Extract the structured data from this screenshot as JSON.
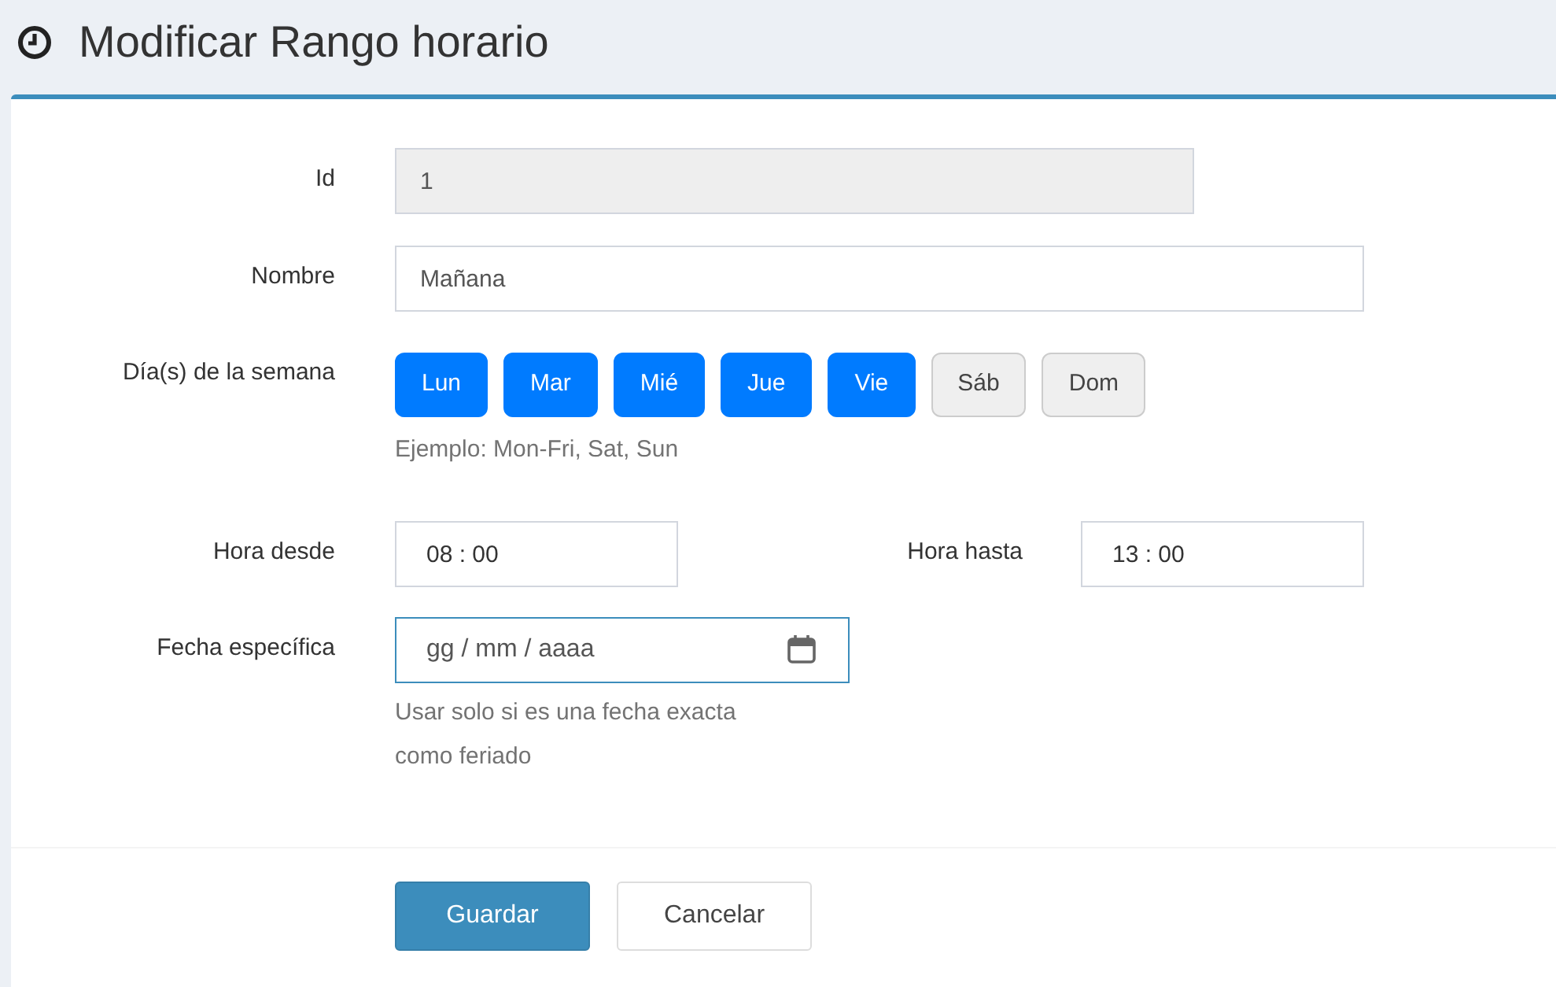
{
  "header": {
    "title": "Modificar Rango horario"
  },
  "form": {
    "id": {
      "label": "Id",
      "value": "1",
      "disabled": true
    },
    "nombre": {
      "label": "Nombre",
      "value": "Mañana",
      "disabled": false
    },
    "days": {
      "label": "Día(s) de la semana",
      "options": [
        {
          "label": "Lun",
          "selected": true
        },
        {
          "label": "Mar",
          "selected": true
        },
        {
          "label": "Mié",
          "selected": true
        },
        {
          "label": "Jue",
          "selected": true
        },
        {
          "label": "Vie",
          "selected": true
        },
        {
          "label": "Sáb",
          "selected": false
        },
        {
          "label": "Dom",
          "selected": false
        }
      ],
      "help": "Ejemplo: Mon-Fri, Sat, Sun"
    },
    "hora_desde": {
      "label": "Hora desde",
      "value": "08 : 00"
    },
    "hora_hasta": {
      "label": "Hora hasta",
      "value": "13 : 00"
    },
    "fecha": {
      "label": "Fecha específica",
      "placeholder": "gg / mm / aaaa",
      "focused": true,
      "help": "Usar solo si es una fecha exacta como feriado"
    }
  },
  "actions": [
    {
      "label": "Guardar",
      "kind": "primary"
    },
    {
      "label": "Cancelar",
      "kind": "default"
    }
  ]
}
